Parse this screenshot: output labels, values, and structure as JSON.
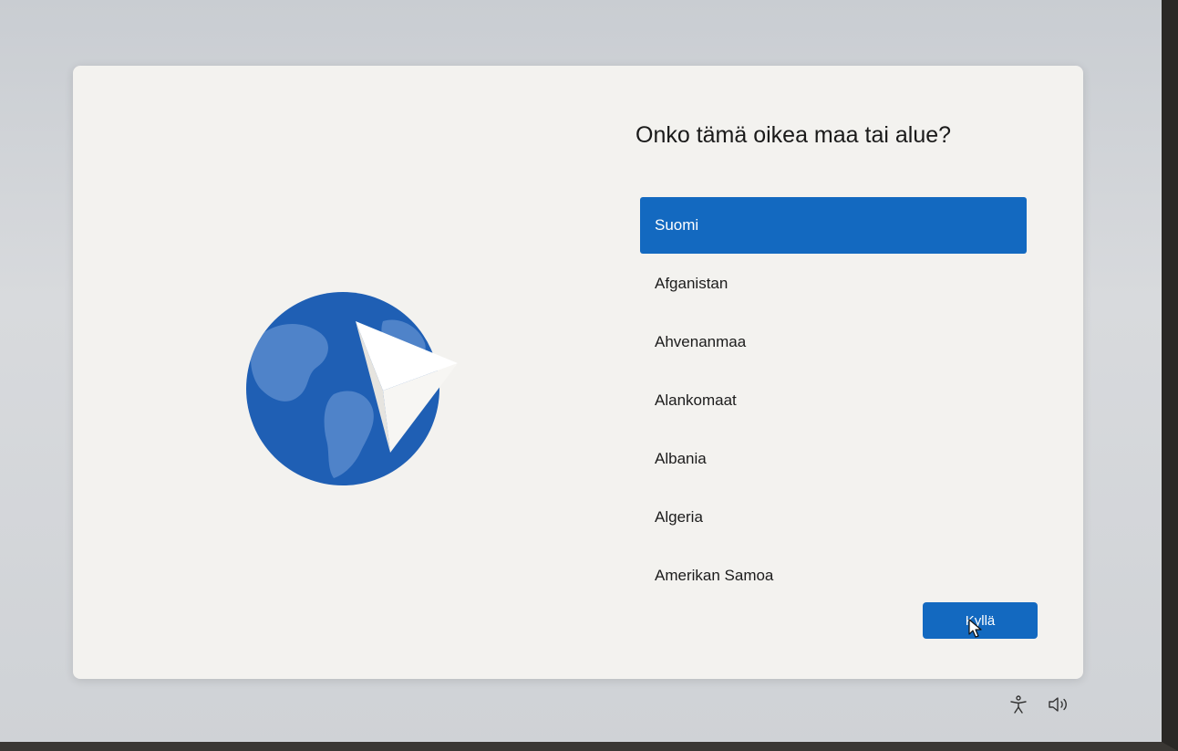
{
  "setup": {
    "title": "Onko tämä oikea maa tai alue?",
    "countries": [
      {
        "label": "Suomi",
        "selected": true
      },
      {
        "label": "Afganistan",
        "selected": false
      },
      {
        "label": "Ahvenanmaa",
        "selected": false
      },
      {
        "label": "Alankomaat",
        "selected": false
      },
      {
        "label": "Albania",
        "selected": false
      },
      {
        "label": "Algeria",
        "selected": false
      },
      {
        "label": "Amerikan Samoa",
        "selected": false
      }
    ],
    "next_button_label": "Kyllä"
  },
  "illustration": {
    "icon": "globe-with-paper-plane-icon"
  },
  "system_tray": {
    "icons": [
      "accessibility-icon",
      "volume-icon"
    ]
  },
  "colors": {
    "accent": "#1369c0",
    "card_background": "#f3f2ef",
    "globe_dark": "#1f5fb4",
    "globe_land": "#4f83c9"
  }
}
